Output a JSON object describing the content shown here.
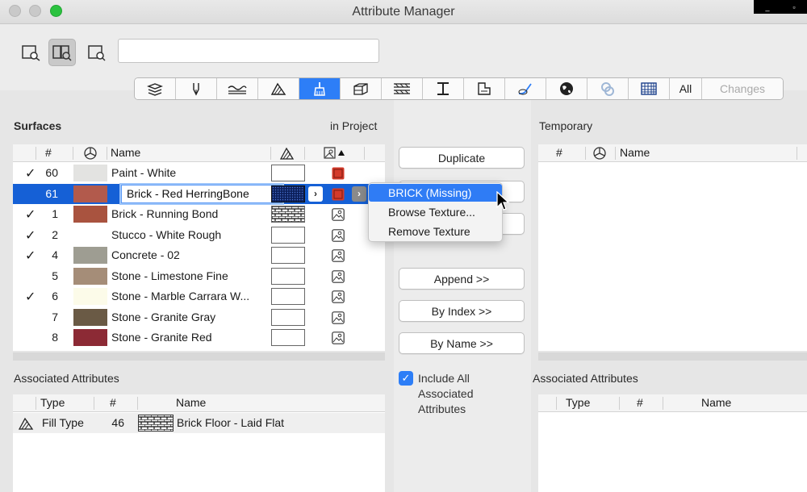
{
  "window": {
    "title": "Attribute Manager",
    "os_min": "_",
    "os_max": "▫"
  },
  "search": {
    "value": "",
    "placeholder": ""
  },
  "tabs": {
    "all_label": "All",
    "changes_label": "Changes"
  },
  "left": {
    "title": "Surfaces",
    "in_project": "in Project",
    "headers": {
      "num": "#",
      "name": "Name"
    },
    "rows": [
      {
        "checked": "✓",
        "num": "60",
        "name": "Paint - White",
        "color": "#e3e3e1"
      },
      {
        "checked": "",
        "num": "61",
        "name": "Brick - Red HerringBone",
        "color": "#b25a4c"
      },
      {
        "checked": "✓",
        "num": "1",
        "name": "Brick - Running Bond",
        "color": "#a9533f"
      },
      {
        "checked": "✓",
        "num": "2",
        "name": "Stucco - White Rough",
        "color": "#ffffff"
      },
      {
        "checked": "✓",
        "num": "4",
        "name": "Concrete - 02",
        "color": "#9e9d92"
      },
      {
        "checked": "",
        "num": "5",
        "name": "Stone - Limestone Fine",
        "color": "#a58d78"
      },
      {
        "checked": "✓",
        "num": "6",
        "name": "Stone - Marble Carrara W...",
        "color": "#fcfbe9"
      },
      {
        "checked": "",
        "num": "7",
        "name": "Stone - Granite Gray",
        "color": "#6a5a45"
      },
      {
        "checked": "",
        "num": "8",
        "name": "Stone - Granite Red",
        "color": "#8c2a35"
      }
    ]
  },
  "buttons": {
    "duplicate": "Duplicate",
    "append": "Append >>",
    "by_index": "By Index >>",
    "by_name": "By Name >>"
  },
  "menu": {
    "items": [
      "BRICK (Missing)",
      "Browse Texture...",
      "Remove Texture"
    ]
  },
  "include": {
    "label": "Include All Associated Attributes",
    "check": "✓"
  },
  "right": {
    "title": "Temporary",
    "headers": {
      "num": "#",
      "name": "Name"
    }
  },
  "assoc_left": {
    "title": "Associated Attributes",
    "headers": {
      "type": "Type",
      "num": "#",
      "name": "Name"
    },
    "rows": [
      {
        "type": "Fill Type",
        "num": "46",
        "name": "Brick Floor - Laid Flat"
      }
    ]
  },
  "assoc_right": {
    "title": "Associated Attributes",
    "headers": {
      "type": "Type",
      "num": "#",
      "name": "Name"
    }
  }
}
